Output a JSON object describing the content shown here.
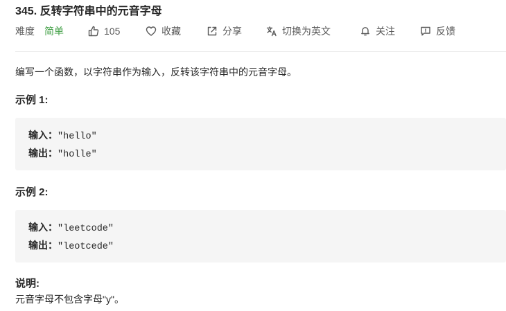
{
  "problem": {
    "title": "345. 反转字符串中的元音字母",
    "difficulty_label": "难度",
    "difficulty_value": "简单",
    "difficulty_color": "#43a047",
    "toolbar": {
      "likes": "105",
      "favorite": "收藏",
      "share": "分享",
      "translate": "切换为英文",
      "follow": "关注",
      "feedback": "反馈"
    },
    "icons": {
      "likes": "thumbs-up-icon",
      "favorite": "heart-icon",
      "share": "share-icon",
      "translate": "translate-icon",
      "follow": "bell-icon",
      "feedback": "feedback-icon"
    },
    "description": "编写一个函数，以字符串作为输入，反转该字符串中的元音字母。",
    "examples": [
      {
        "title": "示例 1:",
        "input_label": "输入：",
        "input_value": "\"hello\"",
        "output_label": "输出：",
        "output_value": "\"holle\""
      },
      {
        "title": "示例 2:",
        "input_label": "输入：",
        "input_value": "\"leetcode\"",
        "output_label": "输出：",
        "output_value": "\"leotcede\""
      }
    ],
    "note_title": "说明:",
    "note_text": "元音字母不包含字母\"y\"。"
  }
}
